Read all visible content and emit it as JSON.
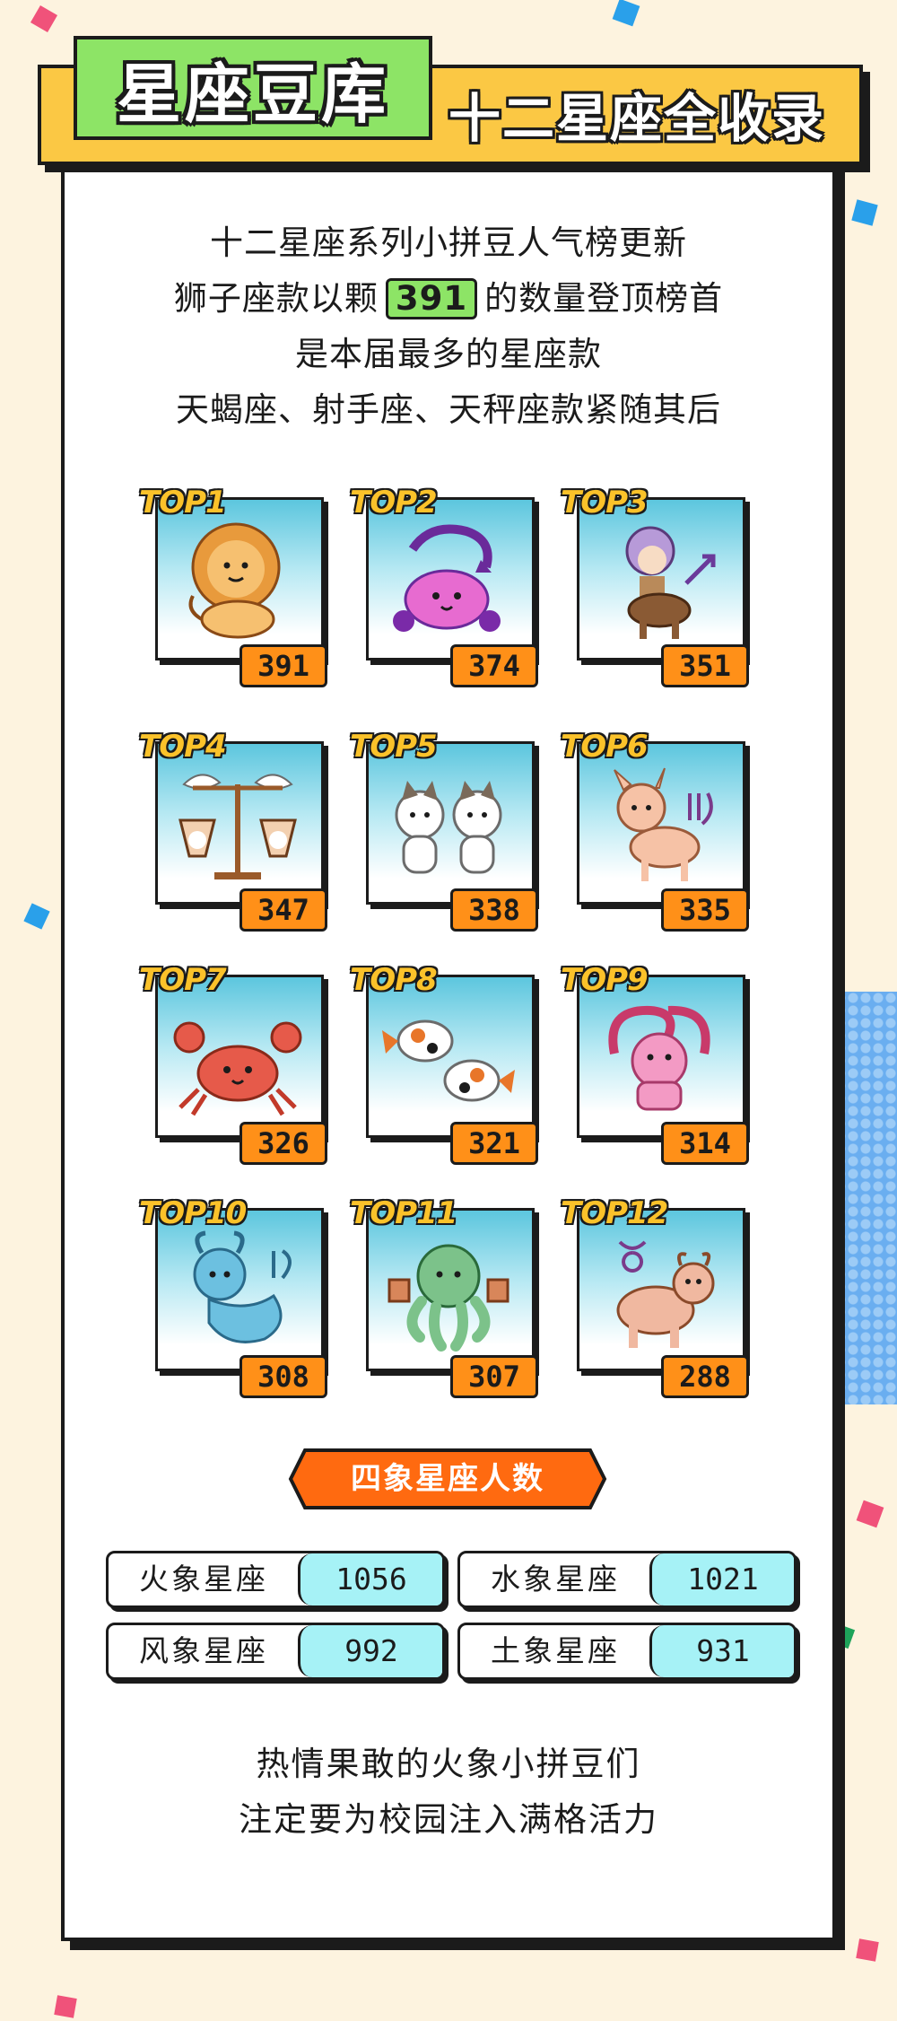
{
  "header": {
    "title": "星座豆库",
    "subtitle": "十二星座全收录"
  },
  "intro": {
    "line1": "十二星座系列小拼豆人气榜更新",
    "line2_prefix": "狮子座款以颗",
    "line2_highlight": "391",
    "line2_suffix": "的数量登顶榜首",
    "line3": "是本届最多的星座款",
    "line4": "天蝎座、射手座、天秤座款紧随其后"
  },
  "ranking": [
    {
      "label": "TOP1",
      "count": "391",
      "figure": "lion-icon"
    },
    {
      "label": "TOP2",
      "count": "374",
      "figure": "scorpion-icon"
    },
    {
      "label": "TOP3",
      "count": "351",
      "figure": "centaur-icon"
    },
    {
      "label": "TOP4",
      "count": "347",
      "figure": "scales-icon"
    },
    {
      "label": "TOP5",
      "count": "338",
      "figure": "twin-cats-icon"
    },
    {
      "label": "TOP6",
      "count": "335",
      "figure": "deer-icon"
    },
    {
      "label": "TOP7",
      "count": "326",
      "figure": "crab-icon"
    },
    {
      "label": "TOP8",
      "count": "321",
      "figure": "koi-fish-icon"
    },
    {
      "label": "TOP9",
      "count": "314",
      "figure": "ram-icon"
    },
    {
      "label": "TOP10",
      "count": "308",
      "figure": "sea-goat-icon"
    },
    {
      "label": "TOP11",
      "count": "307",
      "figure": "octopus-icon"
    },
    {
      "label": "TOP12",
      "count": "288",
      "figure": "bull-icon"
    }
  ],
  "elements": {
    "banner": "四象星座人数",
    "fire": {
      "name": "火象星座",
      "value": "1056"
    },
    "water": {
      "name": "水象星座",
      "value": "1021"
    },
    "air": {
      "name": "风象星座",
      "value": "992"
    },
    "earth": {
      "name": "土象星座",
      "value": "931"
    }
  },
  "outro": {
    "line1": "热情果敢的火象小拼豆们",
    "line2": "注定要为校园注入满格活力"
  },
  "colors": {
    "background": "#fdf3df",
    "header": "#fbc844",
    "title": "#8de466",
    "badge": "#ff9018",
    "value_cell": "#a6f2f6",
    "banner": "#ff6a10"
  }
}
